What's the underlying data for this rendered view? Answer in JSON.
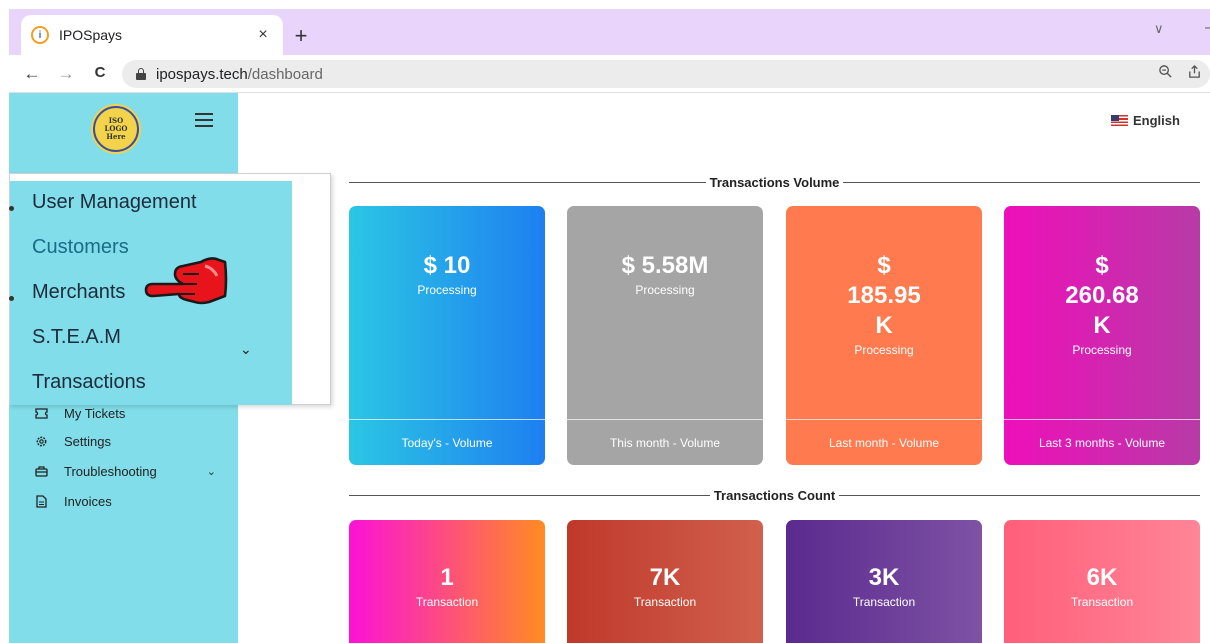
{
  "browser": {
    "tab_title": "IPOSpays",
    "tab_favicon": "i",
    "tab_close": "×",
    "new_tab": "+",
    "url_host": "ipospays.tech",
    "url_path": "/dashboard",
    "back": "←",
    "forward": "→",
    "reload": "C",
    "window_chevron": "∨",
    "window_min": "—"
  },
  "sidebar": {
    "logo_text": [
      "ISO",
      "LOGO",
      "Here"
    ],
    "items": [
      {
        "label": "My Tickets",
        "icon": "ticket-icon"
      },
      {
        "label": "Settings",
        "icon": "gear-icon"
      },
      {
        "label": "Troubleshooting",
        "icon": "toolbox-icon",
        "chevron": "⌄"
      },
      {
        "label": "Invoices",
        "icon": "document-icon"
      }
    ]
  },
  "menu": {
    "items": [
      "User Management",
      "Customers",
      "Merchants",
      "S.T.E.A.M",
      "Transactions"
    ],
    "active_item": "Customers",
    "steam_chevron": "⌄"
  },
  "language": {
    "label": "English",
    "flag": "us-flag-icon"
  },
  "volume": {
    "title": "Transactions Volume",
    "cards": [
      {
        "value": "$ 10",
        "label": "Processing",
        "footer": "Today's - Volume",
        "colors": [
          "#2bc6e4",
          "#1e7ff0"
        ]
      },
      {
        "value": "$ 5.58M",
        "label": "Processing",
        "footer": "This month - Volume",
        "colors": [
          "#a5a5a5",
          "#a5a5a5"
        ]
      },
      {
        "value": "$ 185.95 K",
        "label": "Processing",
        "footer": "Last month - Volume",
        "colors": [
          "#ff7a4e",
          "#ff7a4e"
        ]
      },
      {
        "value": "$ 260.68 K",
        "label": "Processing",
        "footer": "Last 3 months - Volume",
        "colors": [
          "#ee0fba",
          "#b83aa6"
        ]
      }
    ]
  },
  "count": {
    "title": "Transactions Count",
    "cards": [
      {
        "value": "1",
        "label": "Transaction",
        "colors": [
          "#fb12d6",
          "#ff8c22"
        ]
      },
      {
        "value": "7K",
        "label": "Transaction",
        "colors": [
          "#c0392b",
          "#d0604c"
        ]
      },
      {
        "value": "3K",
        "label": "Transaction",
        "colors": [
          "#5a2a8e",
          "#7e52a4"
        ]
      },
      {
        "value": "6K",
        "label": "Transaction",
        "colors": [
          "#ff5f7a",
          "#ff8597"
        ]
      }
    ]
  }
}
